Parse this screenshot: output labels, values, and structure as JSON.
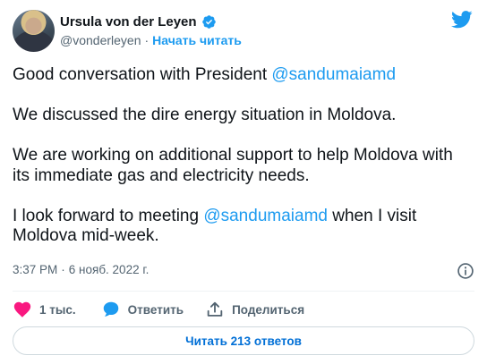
{
  "author": {
    "display_name": "Ursula von der Leyen",
    "handle": "@vonderleyen",
    "separator": "·",
    "follow_label": "Начать читать",
    "avatar_icon": "avatar-photo",
    "verified_icon": "verified-badge-icon"
  },
  "tweet": {
    "lines": [
      {
        "pre": "Good conversation with President ",
        "mention": "@sandumaiamd",
        "post": ""
      },
      {
        "pre": "We discussed the dire energy situation in Moldova.",
        "mention": "",
        "post": ""
      },
      {
        "pre": "We are working on additional support to help Moldova with its immediate gas and electricity needs.",
        "mention": "",
        "post": ""
      },
      {
        "pre": "I look forward to meeting ",
        "mention": "@sandumaiamd",
        "post": " when I visit Moldova  mid-week."
      }
    ]
  },
  "meta": {
    "time": "3:37 PM",
    "dot": "·",
    "date": "6 нояб. 2022 г."
  },
  "actions": {
    "like_count": "1 тыс.",
    "reply_label": "Ответить",
    "share_label": "Поделиться"
  },
  "footer": {
    "read_replies_label": "Читать 213 ответов"
  },
  "colors": {
    "accent": "#1d9bf0",
    "like": "#f91880",
    "muted": "#536471",
    "text": "#0f1419"
  }
}
